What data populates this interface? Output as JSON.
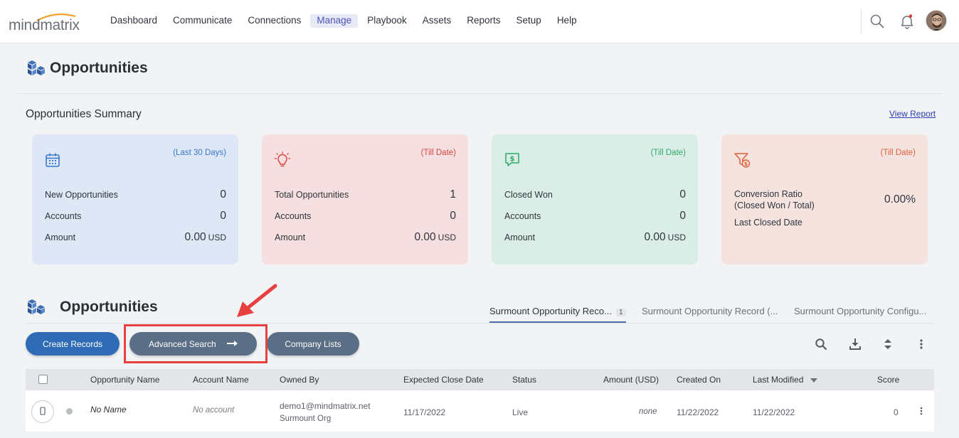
{
  "brand": {
    "logo_text": "mindmatrix",
    "accent": "#4c55b5"
  },
  "nav": {
    "items": [
      {
        "label": "Dashboard"
      },
      {
        "label": "Communicate"
      },
      {
        "label": "Connections"
      },
      {
        "label": "Manage",
        "active": true
      },
      {
        "label": "Playbook"
      },
      {
        "label": "Assets"
      },
      {
        "label": "Reports"
      },
      {
        "label": "Setup"
      },
      {
        "label": "Help"
      }
    ],
    "icons": [
      "search-icon",
      "bell-icon",
      "user-avatar"
    ]
  },
  "page": {
    "title": "Opportunities"
  },
  "summary": {
    "title": "Opportunities Summary",
    "view_report": "View Report",
    "cards": [
      {
        "icon": "calendar-icon",
        "period": "(Last 30 Days)",
        "bg": "#dde7f5",
        "period_color": "#3a78c9",
        "rows": [
          {
            "label": "New Opportunities",
            "value": "0",
            "unit": ""
          },
          {
            "label": "Accounts",
            "value": "0",
            "unit": ""
          },
          {
            "label": "Amount",
            "value": "0.00",
            "unit": "USD"
          }
        ]
      },
      {
        "icon": "lightbulb-icon",
        "period": "(Till Date)",
        "bg": "#f5dfe1",
        "period_color": "#d9463f",
        "rows": [
          {
            "label": "Total Opportunities",
            "value": "1",
            "unit": ""
          },
          {
            "label": "Accounts",
            "value": "0",
            "unit": ""
          },
          {
            "label": "Amount",
            "value": "0.00",
            "unit": "USD"
          }
        ]
      },
      {
        "icon": "dollar-chat-icon",
        "period": "(Till Date)",
        "bg": "#daeee7",
        "period_color": "#2faa6a",
        "rows": [
          {
            "label": "Closed Won",
            "value": "0",
            "unit": ""
          },
          {
            "label": "Accounts",
            "value": "0",
            "unit": ""
          },
          {
            "label": "Amount",
            "value": "0.00",
            "unit": "USD"
          }
        ]
      },
      {
        "icon": "funnel-dollar-icon",
        "period": "(Till Date)",
        "bg": "#f4e3df",
        "period_color": "#e0603c",
        "conversion_label_1": "Conversion Ratio",
        "conversion_label_2": "(Closed Won / Total)",
        "conversion_value": "0.00%",
        "last_closed_label": "Last Closed Date"
      }
    ]
  },
  "opportunities": {
    "title": "Opportunities",
    "tabs": [
      {
        "label": "Surmount Opportunity Reco...",
        "badge": "1",
        "active": true
      },
      {
        "label": "Surmount Opportunity Record (..."
      },
      {
        "label": "Surmount Opportunity Configu..."
      }
    ],
    "buttons": {
      "create": "Create Records",
      "advanced_search": "Advanced Search",
      "company_lists": "Company Lists"
    },
    "tools": [
      "search-icon",
      "download-icon",
      "sort-icon",
      "more-vertical-icon"
    ],
    "columns": [
      "Opportunity Name",
      "Account Name",
      "Owned By",
      "Expected Close Date",
      "Status",
      "Amount (USD)",
      "Created On",
      "Last Modified",
      "Score"
    ],
    "rows": [
      {
        "name": "No Name",
        "account": "No account",
        "owner_email": "demo1@mindmatrix.net",
        "owner_org": "Surmount Org",
        "close_date": "11/17/2022",
        "status": "Live",
        "amount": "none",
        "created_on": "11/22/2022",
        "last_modified": "11/22/2022",
        "score": "0"
      }
    ]
  }
}
